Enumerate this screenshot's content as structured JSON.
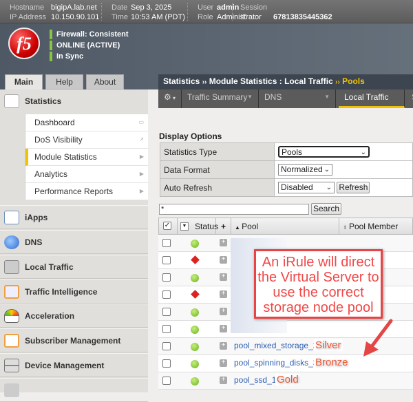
{
  "topbar": {
    "hostname_label": "Hostname",
    "hostname": "bigipA.lab.net",
    "ip_label": "IP Address",
    "ip": "10.150.90.101",
    "date_label": "Date",
    "date": "Sep 3, 2025",
    "time_label": "Time",
    "time": "10:53 AM (PDT)",
    "user_label": "User",
    "user": "admin",
    "role_label": "Role",
    "role": "Administrator",
    "session_label": "Session ID",
    "session": "67813835445362"
  },
  "status": [
    "Firewall: Consistent",
    "ONLINE (ACTIVE)",
    "In Sync"
  ],
  "logo": "f5",
  "tabs": [
    "Main",
    "Help",
    "About"
  ],
  "nav": {
    "statistics": "Statistics",
    "submenu": [
      "Dashboard",
      "DoS Visibility",
      "Module Statistics",
      "Analytics",
      "Performance Reports"
    ],
    "items": [
      "iApps",
      "DNS",
      "Local Traffic",
      "Traffic Intelligence",
      "Acceleration",
      "Subscriber Management",
      "Device Management"
    ]
  },
  "breadcrumb": {
    "a": "Statistics",
    "sep": "››",
    "b": "Module Statistics : Local Traffic",
    "c": "Pools"
  },
  "menubar": [
    "Traffic Summary",
    "DNS",
    "Local Traffic",
    "S"
  ],
  "display_options": {
    "title": "Display Options",
    "rows": [
      {
        "label": "Statistics Type",
        "value": "Pools"
      },
      {
        "label": "Data Format",
        "value": "Normalized"
      },
      {
        "label": "Auto Refresh",
        "value": "Disabled"
      }
    ],
    "refresh": "Refresh"
  },
  "search": {
    "value": "*",
    "button": "Search"
  },
  "grid": {
    "headers": {
      "status": "Status",
      "pool": "Pool",
      "member": "Pool Member"
    },
    "rows": [
      {
        "status": "green",
        "pool": ""
      },
      {
        "status": "red",
        "pool": ""
      },
      {
        "status": "green",
        "pool": ""
      },
      {
        "status": "red",
        "pool": ""
      },
      {
        "status": "green",
        "pool": ""
      },
      {
        "status": "green",
        "pool": ""
      },
      {
        "status": "green",
        "pool": "pool_mixed_storage_2",
        "tag": "Silver"
      },
      {
        "status": "green",
        "pool": "pool_spinning_disks_3",
        "tag": "Bronze"
      },
      {
        "status": "green",
        "pool": "pool_ssd_1",
        "tag": "Gold"
      }
    ]
  },
  "callout": "An iRule will direct the Virtual Server to use the correct storage node pool"
}
